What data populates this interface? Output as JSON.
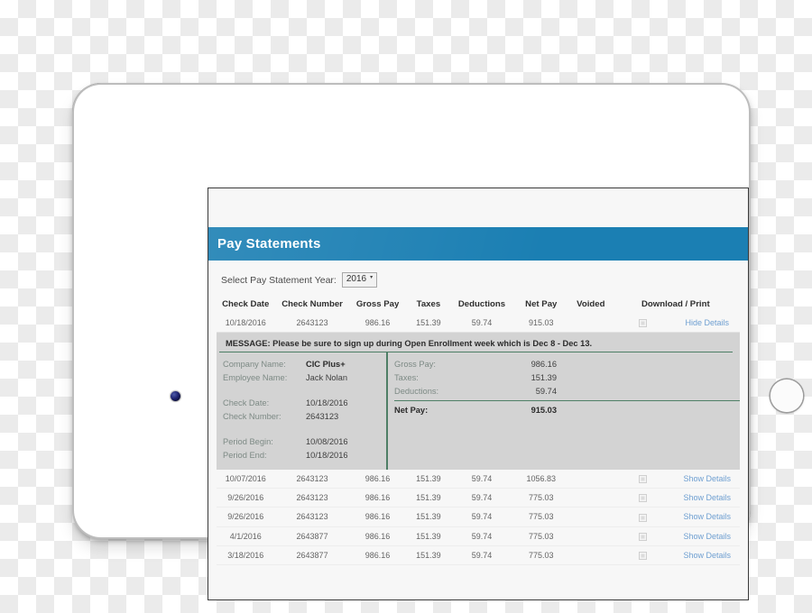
{
  "app": {
    "title": "Pay Statements",
    "header_color": "#1b7fb3"
  },
  "filter": {
    "label": "Select Pay Statement Year:",
    "selected_year": "2016",
    "caret": "▾",
    "options": [
      "2016"
    ]
  },
  "table": {
    "columns": [
      "Check Date",
      "Check Number",
      "Gross Pay",
      "Taxes",
      "Deductions",
      "Net Pay",
      "Voided",
      "Download / Print"
    ],
    "rows": [
      {
        "check_date": "10/18/2016",
        "check_number": "2643123",
        "gross_pay": "986.16",
        "taxes": "151.39",
        "deductions": "59.74",
        "net_pay": "915.03",
        "voided": "",
        "action": "Hide Details",
        "expanded": true
      },
      {
        "check_date": "10/07/2016",
        "check_number": "2643123",
        "gross_pay": "986.16",
        "taxes": "151.39",
        "deductions": "59.74",
        "net_pay": "1056.83",
        "voided": "",
        "action": "Show Details",
        "expanded": false
      },
      {
        "check_date": "9/26/2016",
        "check_number": "2643123",
        "gross_pay": "986.16",
        "taxes": "151.39",
        "deductions": "59.74",
        "net_pay": "775.03",
        "voided": "",
        "action": "Show Details",
        "expanded": false
      },
      {
        "check_date": "9/26/2016",
        "check_number": "2643123",
        "gross_pay": "986.16",
        "taxes": "151.39",
        "deductions": "59.74",
        "net_pay": "775.03",
        "voided": "",
        "action": "Show Details",
        "expanded": false
      },
      {
        "check_date": "4/1/2016",
        "check_number": "2643877",
        "gross_pay": "986.16",
        "taxes": "151.39",
        "deductions": "59.74",
        "net_pay": "775.03",
        "voided": "",
        "action": "Show Details",
        "expanded": false
      },
      {
        "check_date": "3/18/2016",
        "check_number": "2643877",
        "gross_pay": "986.16",
        "taxes": "151.39",
        "deductions": "59.74",
        "net_pay": "775.03",
        "voided": "",
        "action": "Show Details",
        "expanded": false
      }
    ]
  },
  "detail": {
    "message": "MESSAGE: Please be sure to sign up during Open Enrollment week which is Dec 8 - Dec 13.",
    "accent_color": "#4e7f66",
    "panel_color": "#d3d3d3",
    "left": {
      "company_name_label": "Company Name:",
      "company_name_value": "CIC Plus+",
      "employee_name_label": "Employee Name:",
      "employee_name_value": "Jack Nolan",
      "check_date_label": "Check Date:",
      "check_date_value": "10/18/2016",
      "check_number_label": "Check Number:",
      "check_number_value": "2643123",
      "period_begin_label": "Period Begin:",
      "period_begin_value": "10/08/2016",
      "period_end_label": "Period End:",
      "period_end_value": "10/18/2016"
    },
    "right": {
      "gross_pay_label": "Gross Pay:",
      "gross_pay_value": "986.16",
      "taxes_label": "Taxes:",
      "taxes_value": "151.39",
      "deductions_label": "Deductions:",
      "deductions_value": "59.74",
      "net_pay_label": "Net Pay:",
      "net_pay_value": "915.03"
    }
  },
  "device": {
    "camera_icon": "camera-dot",
    "home_icon": "home-button"
  }
}
